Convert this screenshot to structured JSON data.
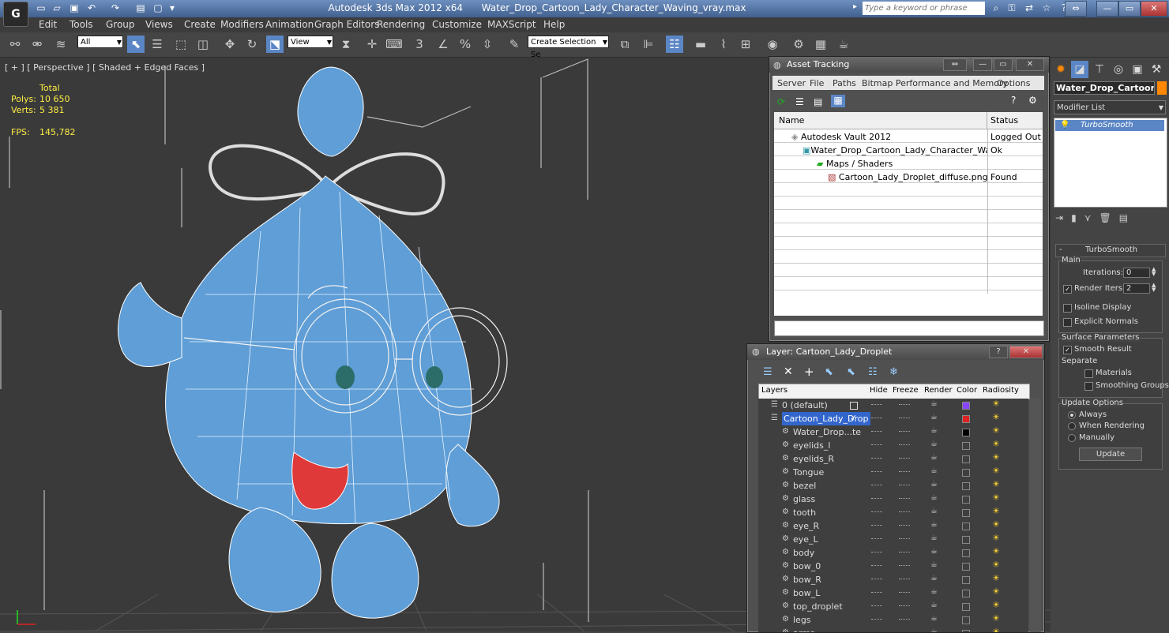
{
  "titlebar": {
    "app_title": "Autodesk 3ds Max  2012 x64",
    "file_title": "Water_Drop_Cartoon_Lady_Character_Waving_vray.max",
    "search_placeholder": "Type a keyword or phrase",
    "app_icon_glyph": "G",
    "quick_access": [
      "new-file-icon",
      "open-icon",
      "save-icon",
      "undo-icon",
      "redo-icon",
      "project-icon",
      "workspace-icon"
    ]
  },
  "menu": {
    "items": [
      "Edit",
      "Tools",
      "Group",
      "Views",
      "Create",
      "Modifiers",
      "Animation",
      "Graph Editors",
      "Rendering",
      "Customize",
      "MAXScript",
      "Help"
    ]
  },
  "toolbar": {
    "selection_filter": "All",
    "ref_coord": "View",
    "named_selection": "Create Selection Se",
    "snap_label": "3"
  },
  "viewport": {
    "label": "[ + ] [ Perspective ] [ Shaded + Edged Faces ]",
    "stats": {
      "total_label": "Total",
      "polys_label": "Polys:",
      "polys_value": "10 650",
      "verts_label": "Verts:",
      "verts_value": "5 381",
      "fps_label": "FPS:",
      "fps_value": "145,782"
    }
  },
  "command_panel": {
    "object_name": "Water_Drop_Cartoon_La",
    "modifier_list": "Modifier List",
    "stack_item": "TurboSmooth",
    "rollout_title": "TurboSmooth",
    "main": {
      "title": "Main",
      "iterations_label": "Iterations:",
      "iterations_value": "0",
      "render_iters_label": "Render Iters:",
      "render_iters_value": "2",
      "isoline": "Isoline Display",
      "explicit": "Explicit Normals"
    },
    "surface": {
      "title": "Surface Parameters",
      "smooth_result": "Smooth Result",
      "separate": "Separate",
      "materials": "Materials",
      "smoothing_groups": "Smoothing Groups"
    },
    "update": {
      "title": "Update Options",
      "always": "Always",
      "when_rendering": "When Rendering",
      "manually": "Manually",
      "update_button": "Update"
    }
  },
  "asset_tracking": {
    "title": "Asset Tracking",
    "menus": [
      "Server",
      "File",
      "Paths",
      "Bitmap Performance and Memory",
      "Options"
    ],
    "col_name": "Name",
    "col_status": "Status",
    "rows": [
      {
        "name": "Autodesk Vault 2012",
        "status": "Logged Out ..."
      },
      {
        "name": "Water_Drop_Cartoon_Lady_Character_Wavin...",
        "status": "Ok"
      },
      {
        "name": "Maps / Shaders",
        "status": ""
      },
      {
        "name": "Cartoon_Lady_Droplet_diffuse.png",
        "status": "Found"
      }
    ]
  },
  "layer_dialog": {
    "title": "Layer: Cartoon_Lady_Droplet",
    "headers": {
      "layers": "Layers",
      "hide": "Hide",
      "freeze": "Freeze",
      "render": "Render",
      "color": "Color",
      "radiosity": "Radiosity"
    },
    "layers": [
      {
        "name": "0 (default)",
        "color": "#8844ff"
      },
      {
        "name": "Cartoon_Lady_Drop",
        "color": "#dd2222"
      },
      {
        "name": "Water_Drop...te",
        "color": "#000000"
      },
      {
        "name": "eyelids_l",
        "color": ""
      },
      {
        "name": "eyelids_R",
        "color": ""
      },
      {
        "name": "Tongue",
        "color": ""
      },
      {
        "name": "bezel",
        "color": ""
      },
      {
        "name": "glass",
        "color": ""
      },
      {
        "name": "tooth",
        "color": ""
      },
      {
        "name": "eye_R",
        "color": ""
      },
      {
        "name": "eye_L",
        "color": ""
      },
      {
        "name": "body",
        "color": ""
      },
      {
        "name": "bow_0",
        "color": ""
      },
      {
        "name": "bow_R",
        "color": ""
      },
      {
        "name": "bow_L",
        "color": ""
      },
      {
        "name": "top_droplet",
        "color": ""
      },
      {
        "name": "legs",
        "color": ""
      },
      {
        "name": "arms",
        "color": ""
      }
    ]
  },
  "colors": {
    "accent": "#5b86c5",
    "model_blue": "#5f9ed6",
    "tongue_red": "#e0393a",
    "stats_yellow": "#ffee44"
  }
}
